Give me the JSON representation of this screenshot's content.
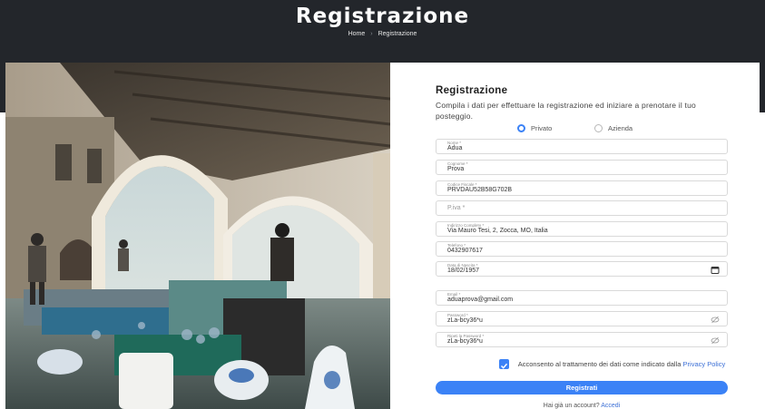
{
  "header": {
    "title": "Registrazione",
    "breadcrumb": {
      "home": "Home",
      "separator": "›",
      "current": "Registrazione"
    }
  },
  "form": {
    "title": "Registrazione",
    "subtitle": "Compila i dati per effettuare la registrazione ed iniziare a prenotare il tuo posteggio.",
    "account_type": {
      "options": [
        "Privato",
        "Azienda"
      ],
      "selected": "Privato"
    },
    "fields": {
      "nome": {
        "label": "Nome *",
        "value": "Adua"
      },
      "cognome": {
        "label": "Cognome *",
        "value": "Prova"
      },
      "codice_fiscale": {
        "label": "Codice Fiscale *",
        "value": "PRVDAU52B58G702B"
      },
      "piva": {
        "placeholder": "P.iva *"
      },
      "indirizzo": {
        "label": "Indirizzo Completo *",
        "value": "Via Mauro Tesi, 2, Zocca, MO, Italia"
      },
      "telefono": {
        "label": "Telefono *",
        "value": "0432907617"
      },
      "data_nascita": {
        "label": "Data di Nascita *",
        "value": "18/02/1957"
      },
      "email": {
        "label": "Email *",
        "value": "aduaprova@gmail.com"
      },
      "password": {
        "label": "Password *",
        "value": "zLa-bcy36*u"
      },
      "ripeti_password": {
        "label": "Ripeti la Password *",
        "value": "zLa-bcy36*u"
      }
    },
    "consent": {
      "text": "Acconsento al trattamento dei dati come indicato dalla",
      "link": "Privacy Policy",
      "checked": true
    },
    "submit_label": "Registrati",
    "login_prompt": "Hai già un account?",
    "login_link": "Accedi"
  },
  "colors": {
    "header_bg": "#23262b",
    "accent": "#3b82f6",
    "link": "#3b6fd6"
  },
  "icons": [
    "calendar-icon",
    "eye-off-icon",
    "check-icon"
  ]
}
